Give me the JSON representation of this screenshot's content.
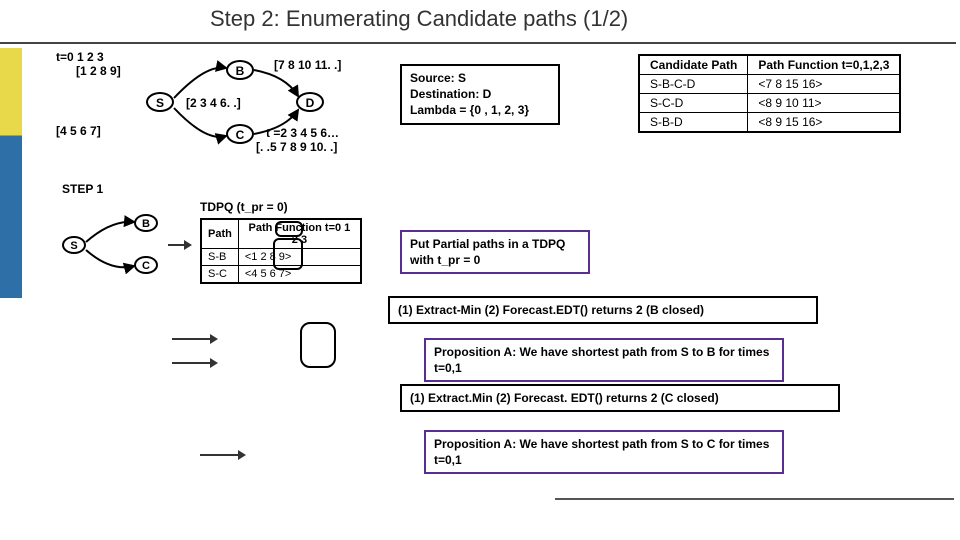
{
  "title": "Step 2: Enumerating Candidate paths (1/2)",
  "net": {
    "node_S": "S",
    "node_B": "B",
    "node_C": "C",
    "node_D": "D",
    "sb_header": "t=0 1 2 3",
    "sb_values": "[1 2 8 9]",
    "sc": "[4 5 6 7]",
    "bd": "[7 8 10 11. .]",
    "sd": "[2 3 4 6. .]",
    "cd_header": "t  =2 3 4 5 6…",
    "cd_values": "[. .5 7 8 9 10. .]"
  },
  "source_box": {
    "l1": "Source: S",
    "l2": "Destination: D",
    "l3": "Lambda = {0 , 1, 2, 3}"
  },
  "cand_table": {
    "h1": "Candidate Path",
    "h2": "Path Function t=0,1,2,3",
    "r1c1": "S-B-C-D",
    "r1c2": "<7 8 15 16>",
    "r2c1": "S-C-D",
    "r2c2": "<8 9 10 11>",
    "r3c1": "S-B-D",
    "r3c2": "<8 9 15 16>"
  },
  "step1_label": "STEP 1",
  "step1": {
    "S": "S",
    "B": "B",
    "C": "C"
  },
  "tdpq": {
    "title": "TDPQ (t_pr = 0)",
    "h1": "Path",
    "h2": "Path Function t=0 1 2 3",
    "r1c1": "S-B",
    "r1c2": "<1 2 8 9>",
    "r2c1": "S-C",
    "r2c2": "<4 5 6 7>"
  },
  "put_box": "Put Partial paths in a TDPQ with t_pr = 0",
  "line1": "(1) Extract-Min (2) Forecast.EDT() returns 2 (B closed)",
  "prop_a1": "Proposition A: We have shortest path from S to B for times t=0,1",
  "line2": "(1) Extract.Min (2) Forecast. EDT() returns 2 (C closed)",
  "prop_a2": "Proposition A: We have shortest path from S to C for times t=0,1"
}
